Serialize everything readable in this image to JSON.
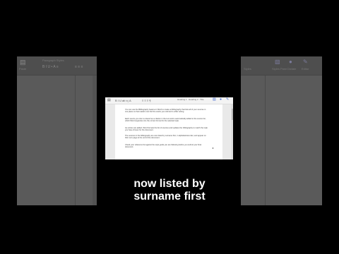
{
  "left_panel": {
    "doc_name": "Paragraph Styles",
    "paste_label": "Paste"
  },
  "right_panel": {
    "ribbon_labels": [
      "Styles",
      "Dictate",
      "Editor"
    ],
    "styles_pane_label": "Styles Pane"
  },
  "center": {
    "ribbon": {
      "style_names": [
        "Heading 1",
        "Heading 2",
        "Title"
      ],
      "buttons": [
        "Styles",
        "Dictate",
        "Editor"
      ]
    },
    "document": {
      "paragraphs": [
        "You can use the Bibliography feature in Word to create a bibliography that lists all of your sources in one place so that readers can find the works you referred to while writing.",
        "Each source you cite is entered as a citation in the text and is automatically added to the source list, which Word organizes into the correct format for the selected style.",
        "As entries are added, Word formats the list of sources and updates the bibliography to match the style you have chosen for the document.",
        "The sources in the bibliography are now listed by surname first, in alphabetical order, and appear on their own page at the end of the document.",
        "Check your reference list against the style guide you are following before you submit your final document."
      ]
    }
  },
  "caption": {
    "line1": "now listed by",
    "line2": "surname first"
  }
}
